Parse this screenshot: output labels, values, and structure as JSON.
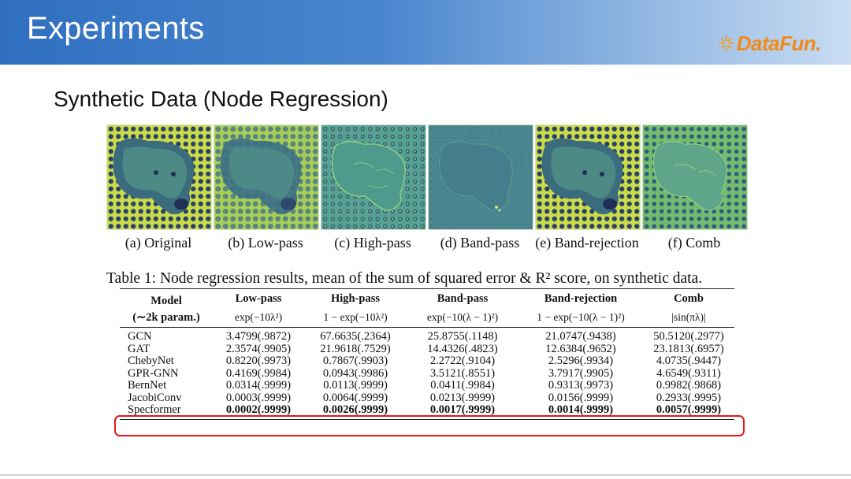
{
  "header": {
    "title": "Experiments"
  },
  "logo": {
    "text": "DataFun."
  },
  "subtitle": "Synthetic Data (Node Regression)",
  "images": [
    {
      "caption": "(a) Original"
    },
    {
      "caption": "(b) Low-pass"
    },
    {
      "caption": "(c) High-pass"
    },
    {
      "caption": "(d) Band-pass"
    },
    {
      "caption": "(e) Band-rejection"
    },
    {
      "caption": "(f) Comb"
    }
  ],
  "table": {
    "caption": "Table 1: Node regression results, mean of the sum of squared error & R² score, on synthetic data.",
    "model_header": "Model",
    "model_subheader": "(∼2k param.)",
    "columns": [
      {
        "name": "Low-pass",
        "formula": "exp(−10λ²)"
      },
      {
        "name": "High-pass",
        "formula": "1 − exp(−10λ²)"
      },
      {
        "name": "Band-pass",
        "formula": "exp(−10(λ − 1)²)"
      },
      {
        "name": "Band-rejection",
        "formula": "1 − exp(−10(λ − 1)²)"
      },
      {
        "name": "Comb",
        "formula": "|sin(πλ)|"
      }
    ],
    "rows": [
      {
        "model": "GCN",
        "values": [
          "3.4799(.9872)",
          "67.6635(.2364)",
          "25.8755(.1148)",
          "21.0747(.9438)",
          "50.5120(.2977)"
        ]
      },
      {
        "model": "GAT",
        "values": [
          "2.3574(.9905)",
          "21.9618(.7529)",
          "14.4326(.4823)",
          "12.6384(.9652)",
          "23.1813(.6957)"
        ]
      },
      {
        "model": "ChebyNet",
        "values": [
          "0.8220(.9973)",
          "0.7867(.9903)",
          "2.2722(.9104)",
          "2.5296(.9934)",
          "4.0735(.9447)"
        ]
      },
      {
        "model": "GPR-GNN",
        "values": [
          "0.4169(.9984)",
          "0.0943(.9986)",
          "3.5121(.8551)",
          "3.7917(.9905)",
          "4.6549(.9311)"
        ]
      },
      {
        "model": "BernNet",
        "values": [
          "0.0314(.9999)",
          "0.0113(.9999)",
          "0.0411(.9984)",
          "0.9313(.9973)",
          "0.9982(.9868)"
        ]
      },
      {
        "model": "JacobiConv",
        "values": [
          "0.0003(.9999)",
          "0.0064(.9999)",
          "0.0213(.9999)",
          "0.0156(.9999)",
          "0.2933(.9995)"
        ]
      },
      {
        "model": "Specformer",
        "values": [
          "0.0002(.9999)",
          "0.0026(.9999)",
          "0.0017(.9999)",
          "0.0014(.9999)",
          "0.0057(.9999)"
        ]
      }
    ]
  }
}
